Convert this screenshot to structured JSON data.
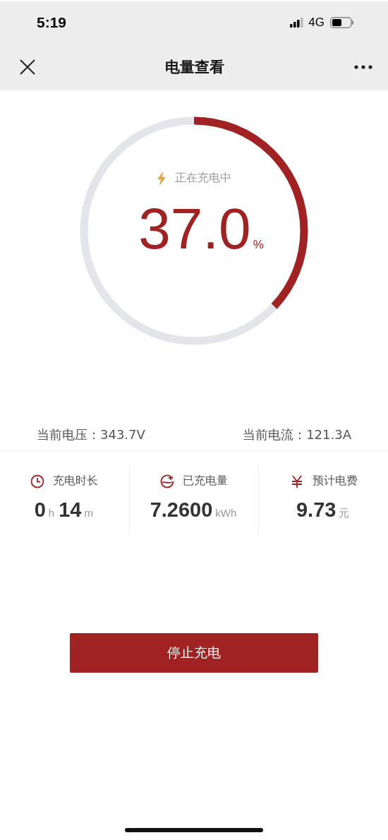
{
  "status_bar": {
    "time": "5:19",
    "network": "4G"
  },
  "nav": {
    "title": "电量查看"
  },
  "gauge": {
    "level": 0.37,
    "status": "正在充电中",
    "value": "37.0",
    "unit": "%"
  },
  "readings": [
    {
      "label": "当前电压：",
      "value": "343.7V"
    },
    {
      "label": "当前电流：",
      "value": "121.3A"
    }
  ],
  "stats": [
    {
      "kind": "clock",
      "label": "充电时长",
      "parts": [
        {
          "number": "0",
          "unit": "h"
        },
        {
          "number": "14",
          "unit": "m"
        }
      ]
    },
    {
      "kind": "energy",
      "label": "已充电量",
      "parts": [
        {
          "number": "7.2600",
          "unit": "kWh"
        }
      ]
    },
    {
      "kind": "money",
      "label": "预计电费",
      "parts": [
        {
          "number": "9.73",
          "unit": "元"
        }
      ]
    }
  ],
  "button": {
    "label": "停止充电"
  }
}
